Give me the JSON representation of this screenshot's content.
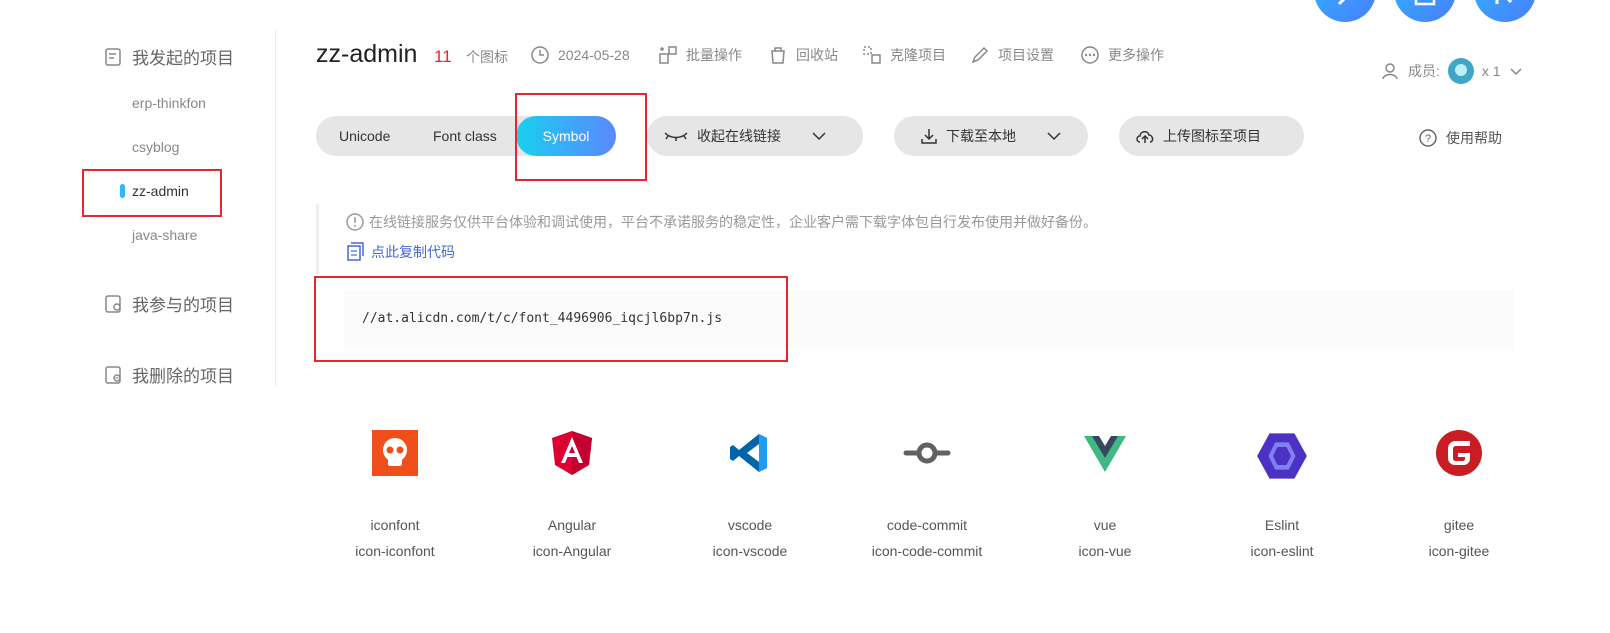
{
  "sidebar": {
    "my_projects": "我发起的项目",
    "items": [
      {
        "label": "erp-thinkfon"
      },
      {
        "label": "csyblog"
      },
      {
        "label": "zz-admin"
      },
      {
        "label": "java-share"
      }
    ],
    "joined_projects": "我参与的项目",
    "deleted_projects": "我删除的项目"
  },
  "header": {
    "title": "zz-admin",
    "icon_count": "11",
    "icon_count_label": "个图标",
    "date": "2024-05-28",
    "batch": "批量操作",
    "recycle": "回收站",
    "clone": "克隆项目",
    "settings": "项目设置",
    "more": "更多操作",
    "members_label": "成员:",
    "members_count": "x 1"
  },
  "tabs": [
    {
      "label": "Unicode"
    },
    {
      "label": "Font class"
    },
    {
      "label": "Symbol",
      "active": true
    }
  ],
  "actions": {
    "collapse_link": "收起在线链接",
    "download": "下载至本地",
    "upload": "上传图标至项目",
    "help": "使用帮助"
  },
  "notice": {
    "text": "在线链接服务仅供平台体验和调试使用，平台不承诺服务的稳定性，企业客户需下载字体包自行发布使用并做好备份。",
    "copy_code": "点此复制代码"
  },
  "code": {
    "url": "//at.alicdn.com/t/c/font_4496906_iqcjl6bp7n.js"
  },
  "icons": [
    {
      "name": "iconfont",
      "code": "icon-iconfont",
      "glyph": "skull-icon",
      "color": "#f04f1c"
    },
    {
      "name": "Angular",
      "code": "icon-Angular",
      "glyph": "angular-icon",
      "color": "#dd0031"
    },
    {
      "name": "vscode",
      "code": "icon-vscode",
      "glyph": "vscode-icon",
      "color": "#1f9cf0"
    },
    {
      "name": "code-commit",
      "code": "icon-code-commit",
      "glyph": "code-commit-icon",
      "color": "#616161"
    },
    {
      "name": "vue",
      "code": "icon-vue",
      "glyph": "vue-icon",
      "color": "#41b883"
    },
    {
      "name": "Eslint",
      "code": "icon-eslint",
      "glyph": "eslint-icon",
      "color": "#4b32c3"
    },
    {
      "name": "gitee",
      "code": "icon-gitee",
      "glyph": "gitee-icon",
      "color": "#c71d23"
    }
  ],
  "colors": {
    "accent_gradient_start": "#18d0f0",
    "accent_gradient_end": "#5b88ff",
    "highlight_red": "#e8262d",
    "link_blue": "#4468d6"
  }
}
